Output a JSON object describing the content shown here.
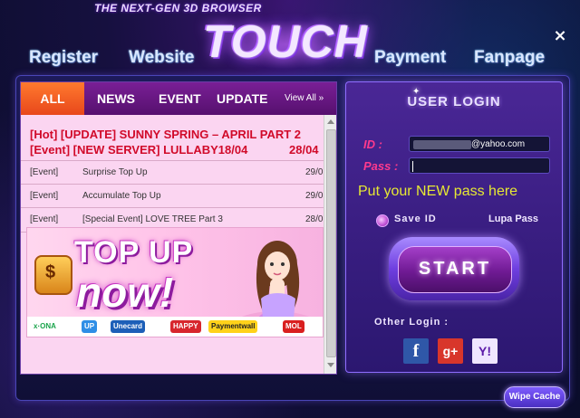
{
  "header": {
    "tagline": "THE NEXT-GEN 3D BROWSER",
    "logo": "TOUCH",
    "nav": {
      "register": "Register",
      "website": "Website",
      "payment": "Payment",
      "fanpage": "Fanpage"
    },
    "close_label": "×"
  },
  "news": {
    "tabs": [
      "ALL",
      "NEWS",
      "EVENT",
      "UPDATE"
    ],
    "view_all": "View All »",
    "highlights": [
      {
        "text": "[Hot]  [UPDATE] SUNNY SPRING – APRIL PART 2",
        "date": ""
      },
      {
        "text": "[Event]  [NEW SERVER] LULLABY18/04",
        "date": "28/04"
      }
    ],
    "rows": [
      {
        "category": "[Event]",
        "title": "Surprise Top Up",
        "date": "29/0"
      },
      {
        "category": "[Event]",
        "title": "Accumulate Top Up",
        "date": "29/0"
      },
      {
        "category": "[Event]",
        "title": "[Special Event] LOVE TREE Part 3",
        "date": "28/0"
      }
    ],
    "banner": {
      "line1": "TOP UP",
      "line2": "now!",
      "currency_symbol": "$",
      "payment_providers": [
        "x·ONA",
        "UP",
        "Unecard",
        "HAPPY",
        "Paymentwall",
        "MOL"
      ]
    }
  },
  "login": {
    "title": "USER LOGIN",
    "id_label": "ID :",
    "id_value": "@yahoo.com",
    "pass_label": "Pass :",
    "hint": "Put your NEW pass here",
    "save_id": "Save ID",
    "forgot": "Lupa Pass",
    "start": "START",
    "other_login": "Other Login :",
    "social": {
      "facebook": "f",
      "google": "g+",
      "yahoo": "Y!"
    }
  },
  "wipe_cache": "Wipe Cache",
  "colors": {
    "accent_orange": "#e8471b",
    "tab_purple": "#6a1886",
    "hot_red": "#d10a2a",
    "label_pink": "#ff3a8d",
    "hint_yellow": "#e6e833",
    "panel_pink": "#fbd5f1"
  }
}
